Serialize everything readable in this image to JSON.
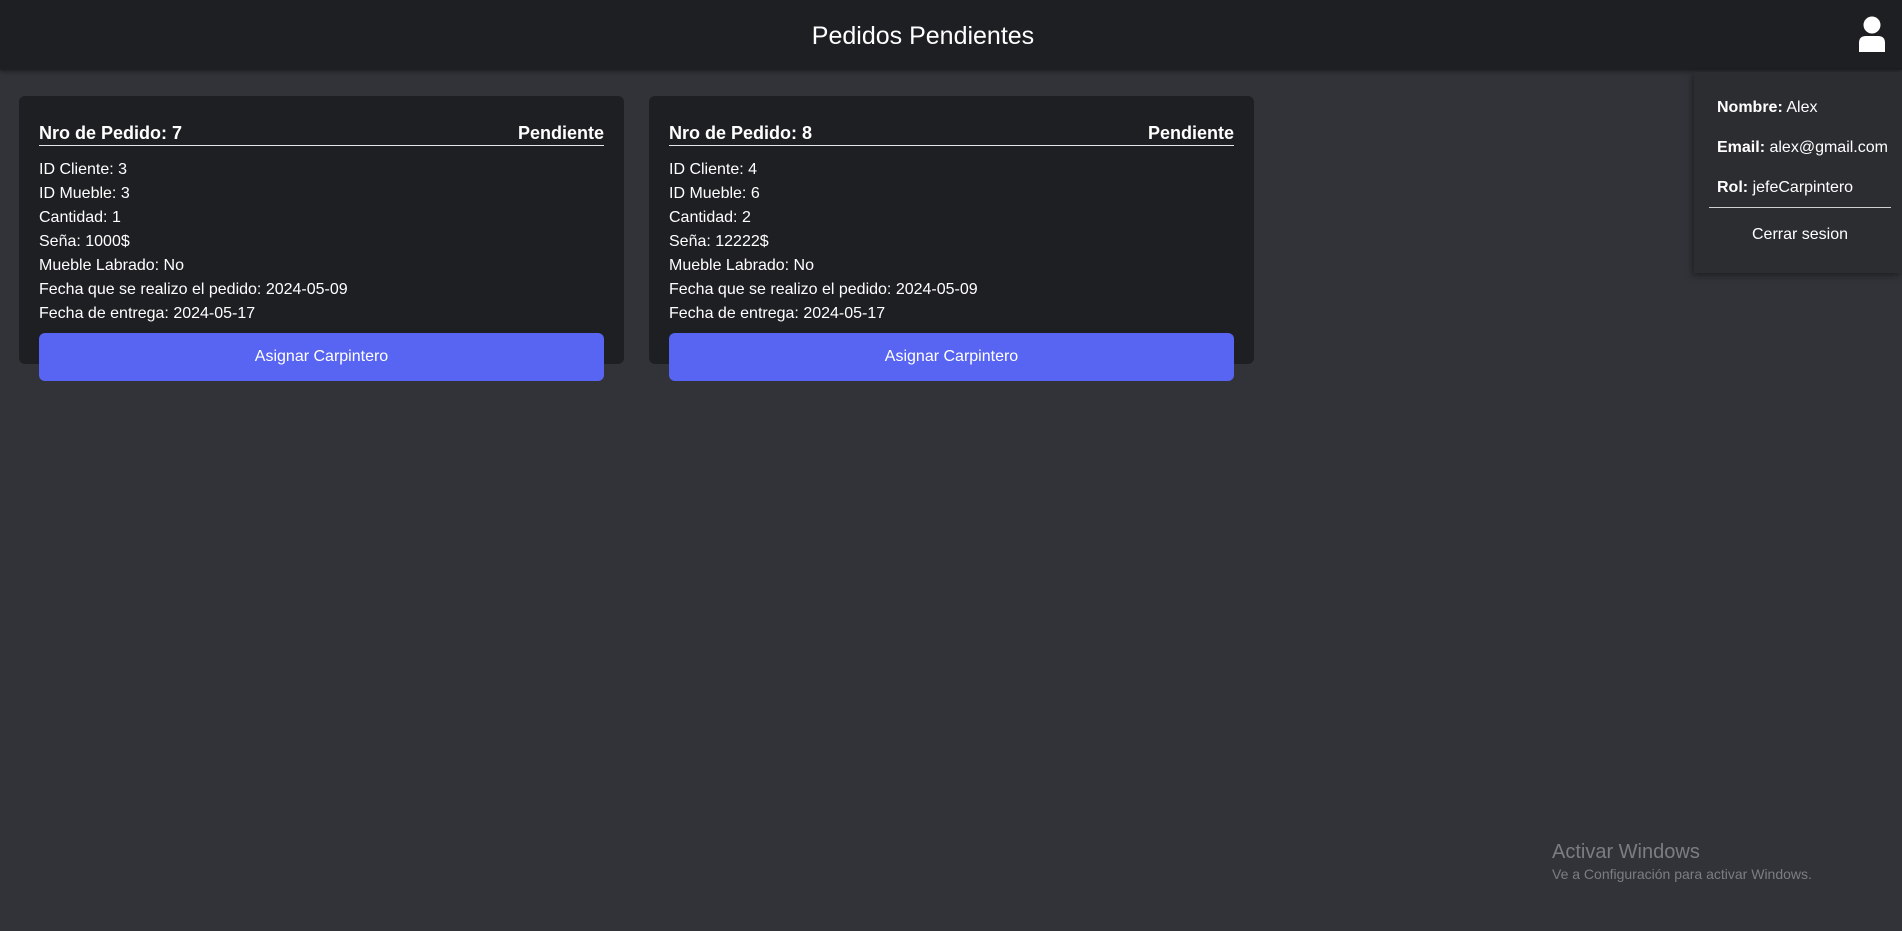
{
  "header": {
    "title": "Pedidos Pendientes",
    "user_icon": "user-icon"
  },
  "orders": [
    {
      "title": "Nro de Pedido: 7",
      "status": "Pendiente",
      "fields": [
        "ID Cliente: 3",
        "ID Mueble: 3",
        "Cantidad: 1",
        "Seña: 1000$",
        "Mueble Labrado: No",
        "Fecha que se realizo el pedido: 2024-05-09",
        "Fecha de entrega: 2024-05-17"
      ],
      "button_label": "Asignar Carpintero"
    },
    {
      "title": "Nro de Pedido: 8",
      "status": "Pendiente",
      "fields": [
        "ID Cliente: 4",
        "ID Mueble: 6",
        "Cantidad: 2",
        "Seña: 12222$",
        "Mueble Labrado: No",
        "Fecha que se realizo el pedido: 2024-05-09",
        "Fecha de entrega: 2024-05-17"
      ],
      "button_label": "Asignar Carpintero"
    }
  ],
  "user_panel": {
    "name_label": "Nombre:",
    "name_value": "Alex",
    "email_label": "Email:",
    "email_value": "alex@gmail.com",
    "role_label": "Rol:",
    "role_value": "jefeCarpintero",
    "logout_label": "Cerrar sesion"
  },
  "watermark": {
    "title": "Activar Windows",
    "subtitle": "Ve a Configuración para activar Windows."
  },
  "colors": {
    "background": "#313338",
    "card": "#1e1f22",
    "accent": "#5865f2"
  }
}
